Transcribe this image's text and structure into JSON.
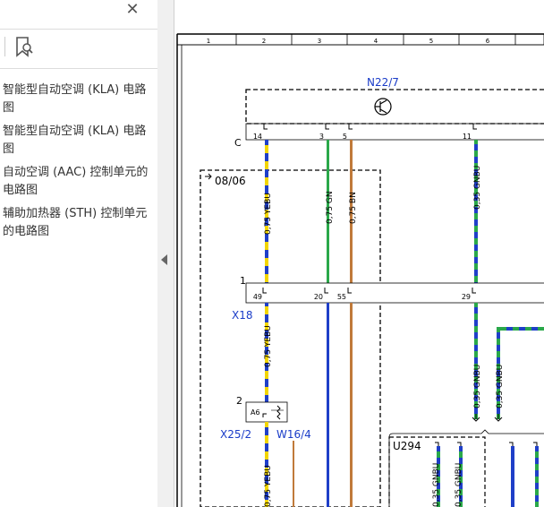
{
  "sidebar": {
    "close_glyph": "✕",
    "toolbar": {
      "bookmark_icon": "bookmark-search-icon"
    },
    "bookmarks": [
      {
        "label": "智能型自动空调 (KLA) 电路图"
      },
      {
        "label": "智能型自动空调 (KLA) 电路图"
      },
      {
        "label": "自动空调 (AAC) 控制单元的电路图"
      },
      {
        "label": "辅助加热器 (STH) 控制单元的电路图"
      }
    ],
    "collapse_icon": "triangle-left-icon"
  },
  "diagram": {
    "ruler": [
      "1",
      "2",
      "3",
      "4",
      "5",
      "6"
    ],
    "component_n22": "N22/7",
    "connector_c": "C",
    "pins_top": [
      "14",
      "3",
      "5",
      "11"
    ],
    "zone_label": "08/06",
    "wires_top": [
      "0,75 YEBU",
      "0,75 GN",
      "0,75 BN",
      "0,35 GNBU"
    ],
    "x18_index": "1",
    "x18_pins": [
      "49",
      "20",
      "55",
      "29"
    ],
    "x18_label": "X18",
    "wire_lower_yebu": "0,75 YEBU",
    "wires_right_lower": [
      "0,35 GNBU",
      "0,35 GNBU"
    ],
    "x25_index": "2",
    "x25_pin": "A6",
    "x25_label": "X25/2",
    "w16_label": "W16/4",
    "u294_label": "U294",
    "u294_wires": [
      "0,35 GNBU",
      "0,35 GNBU"
    ],
    "bottom_wire": "0,75 YEBU",
    "colors": {
      "blue_label": "#1a3cc8",
      "yellow": "#f2d600",
      "blue": "#1f3fc8",
      "green": "#2aa84a",
      "brown": "#c07a3a"
    }
  }
}
